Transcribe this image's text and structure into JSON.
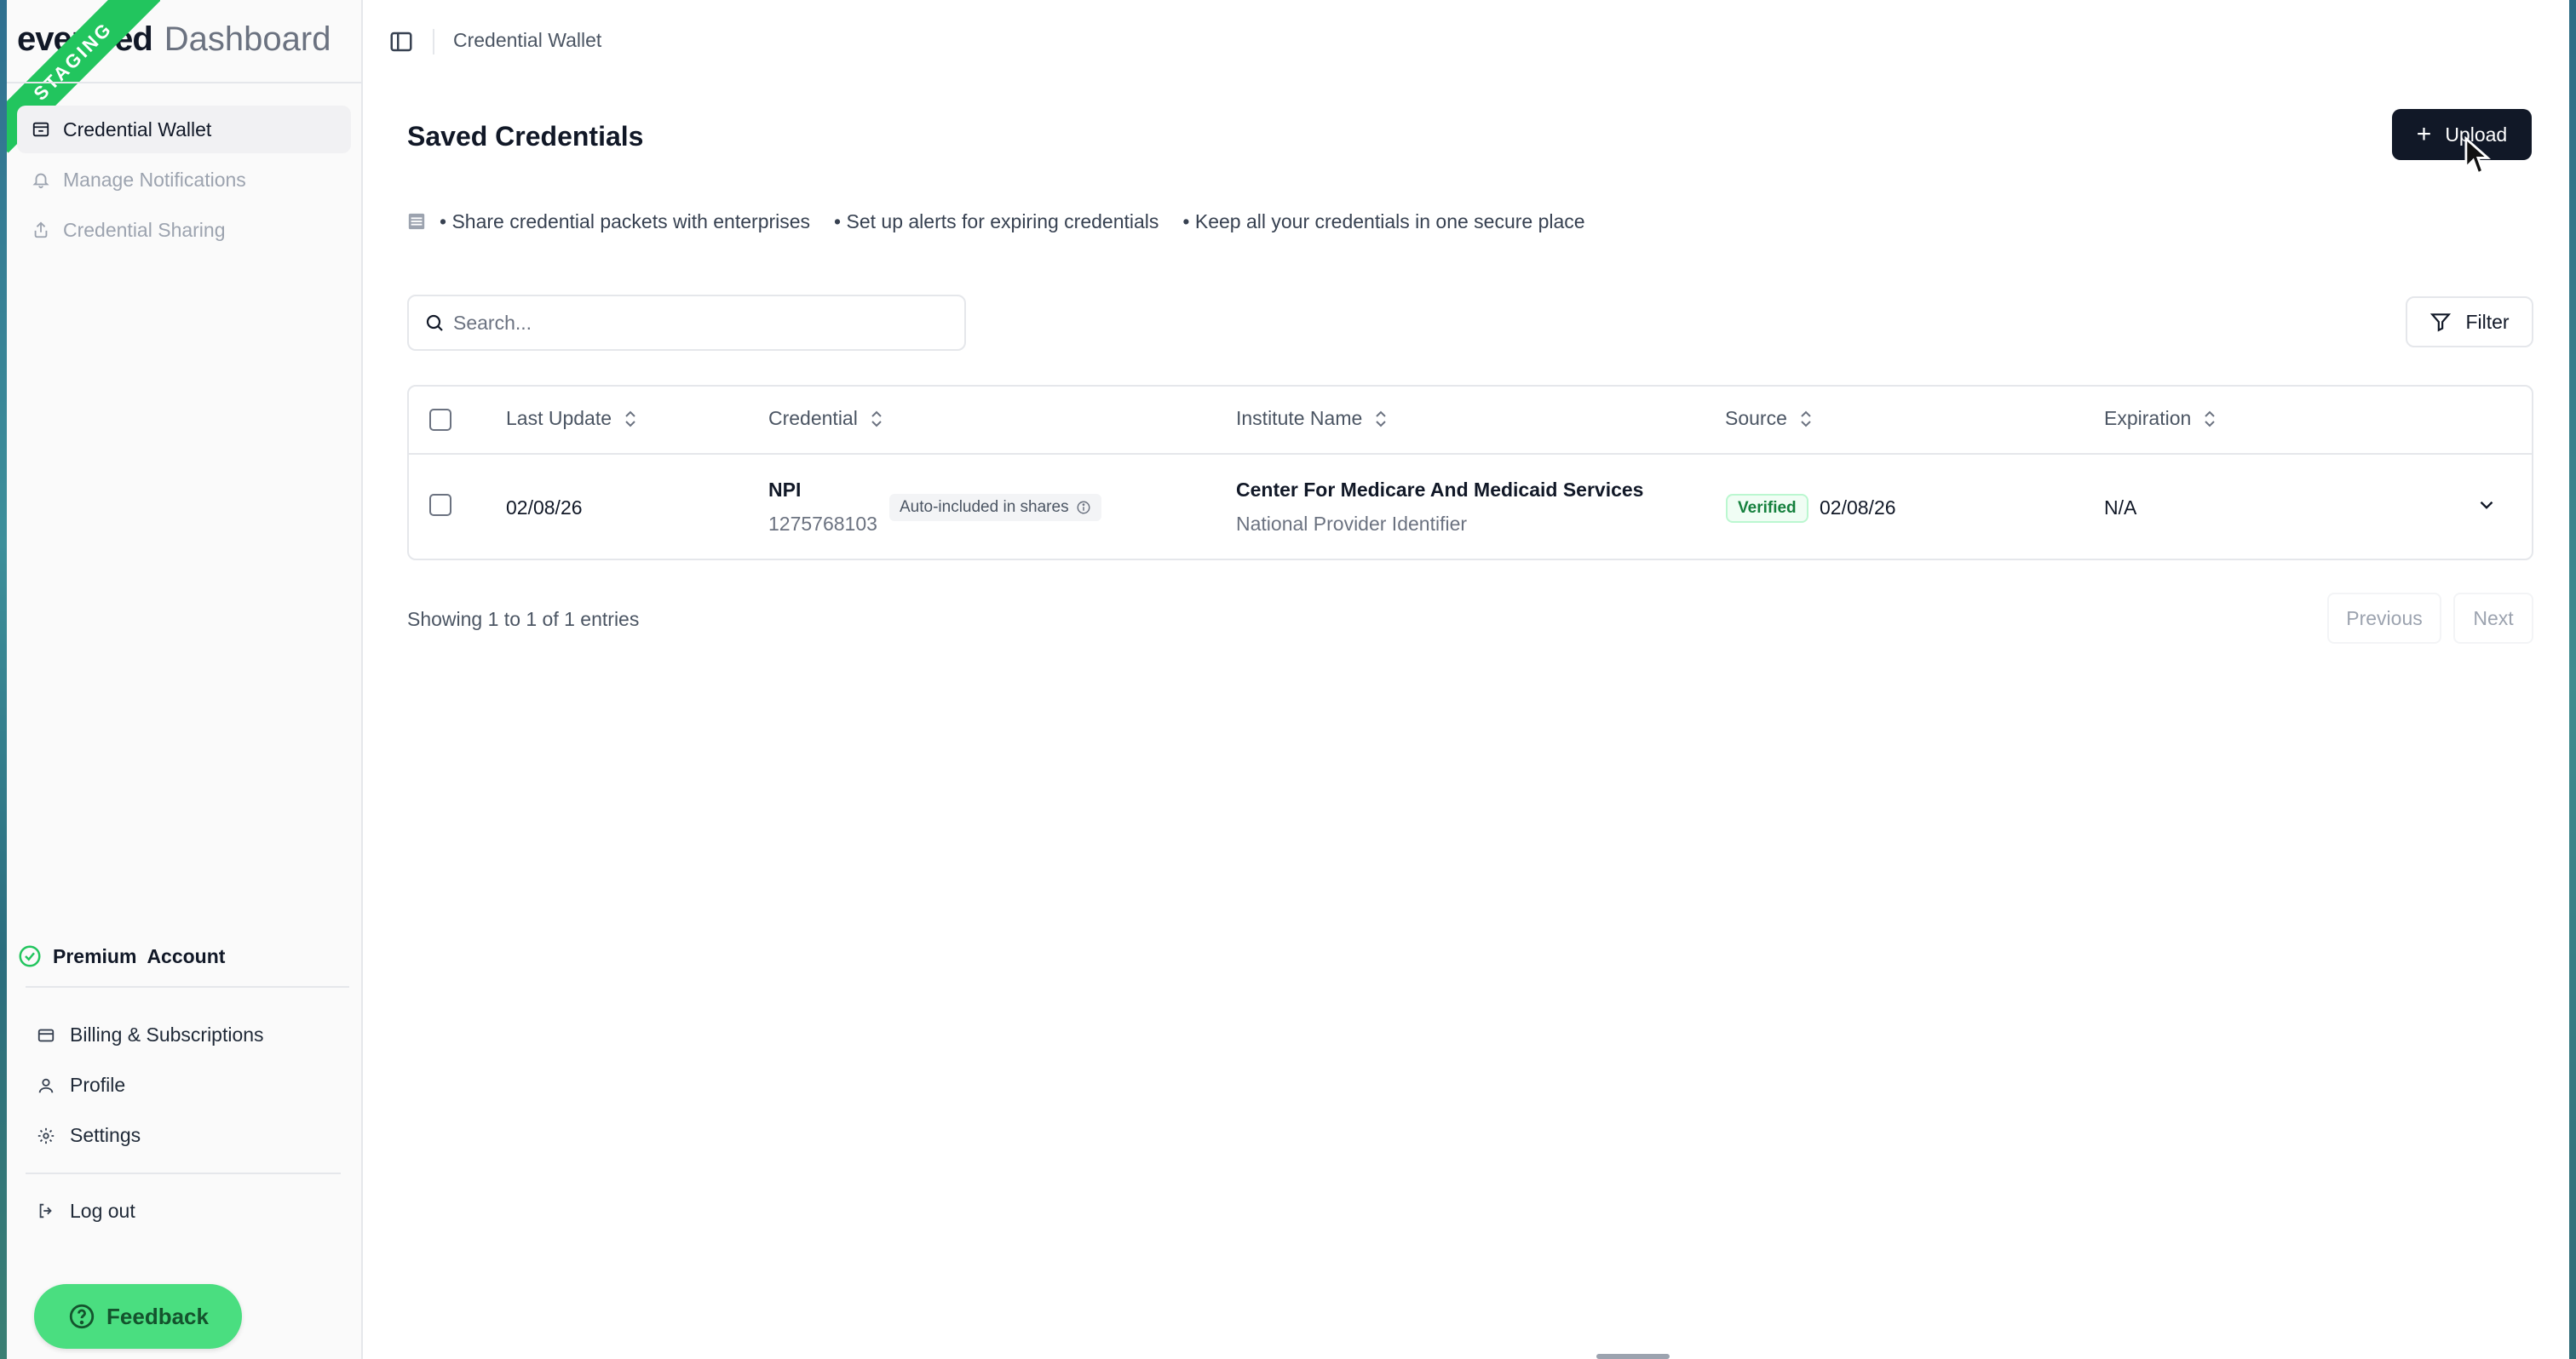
{
  "brand": {
    "logo": "evercred",
    "subtitle": "Dashboard",
    "env_ribbon": "STAGING"
  },
  "sidebar": {
    "nav": [
      {
        "label": "Credential Wallet",
        "icon": "wallet-icon",
        "active": true
      },
      {
        "label": "Manage Notifications",
        "icon": "bell-icon",
        "active": false
      },
      {
        "label": "Credential Sharing",
        "icon": "share-icon",
        "active": false
      }
    ],
    "premium": {
      "word1": "Premium",
      "word2": "Account",
      "icon": "check-circle-icon"
    },
    "account": [
      {
        "label": "Billing & Subscriptions",
        "icon": "credit-card-icon"
      },
      {
        "label": "Profile",
        "icon": "user-icon"
      },
      {
        "label": "Settings",
        "icon": "gear-icon"
      }
    ],
    "logout": "Log out",
    "feedback": "Feedback"
  },
  "topbar": {
    "breadcrumb": "Credential Wallet"
  },
  "page": {
    "title": "Saved Credentials",
    "upload_label": "Upload",
    "features": [
      "• Share credential packets with enterprises",
      "• Set up alerts for expiring credentials",
      "• Keep all your credentials in one secure place"
    ],
    "search_placeholder": "Search...",
    "filter_label": "Filter"
  },
  "table": {
    "columns": [
      "Last Update",
      "Credential",
      "Institute Name",
      "Source",
      "Expiration"
    ],
    "rows": [
      {
        "last_update": "02/08/26",
        "credential_name": "NPI",
        "credential_number": "1275768103",
        "auto_badge": "Auto-included in shares",
        "institute_name": "Center For Medicare And Medicaid Services",
        "institute_sub": "National Provider Identifier",
        "source_badge": "Verified",
        "source_date": "02/08/26",
        "expiration": "N/A"
      }
    ]
  },
  "pagination": {
    "showing": "Showing 1 to 1 of 1 entries",
    "previous": "Previous",
    "next": "Next"
  },
  "colors": {
    "accent_green": "#22c55e",
    "primary_dark": "#111827",
    "verified_text": "#15803d"
  }
}
